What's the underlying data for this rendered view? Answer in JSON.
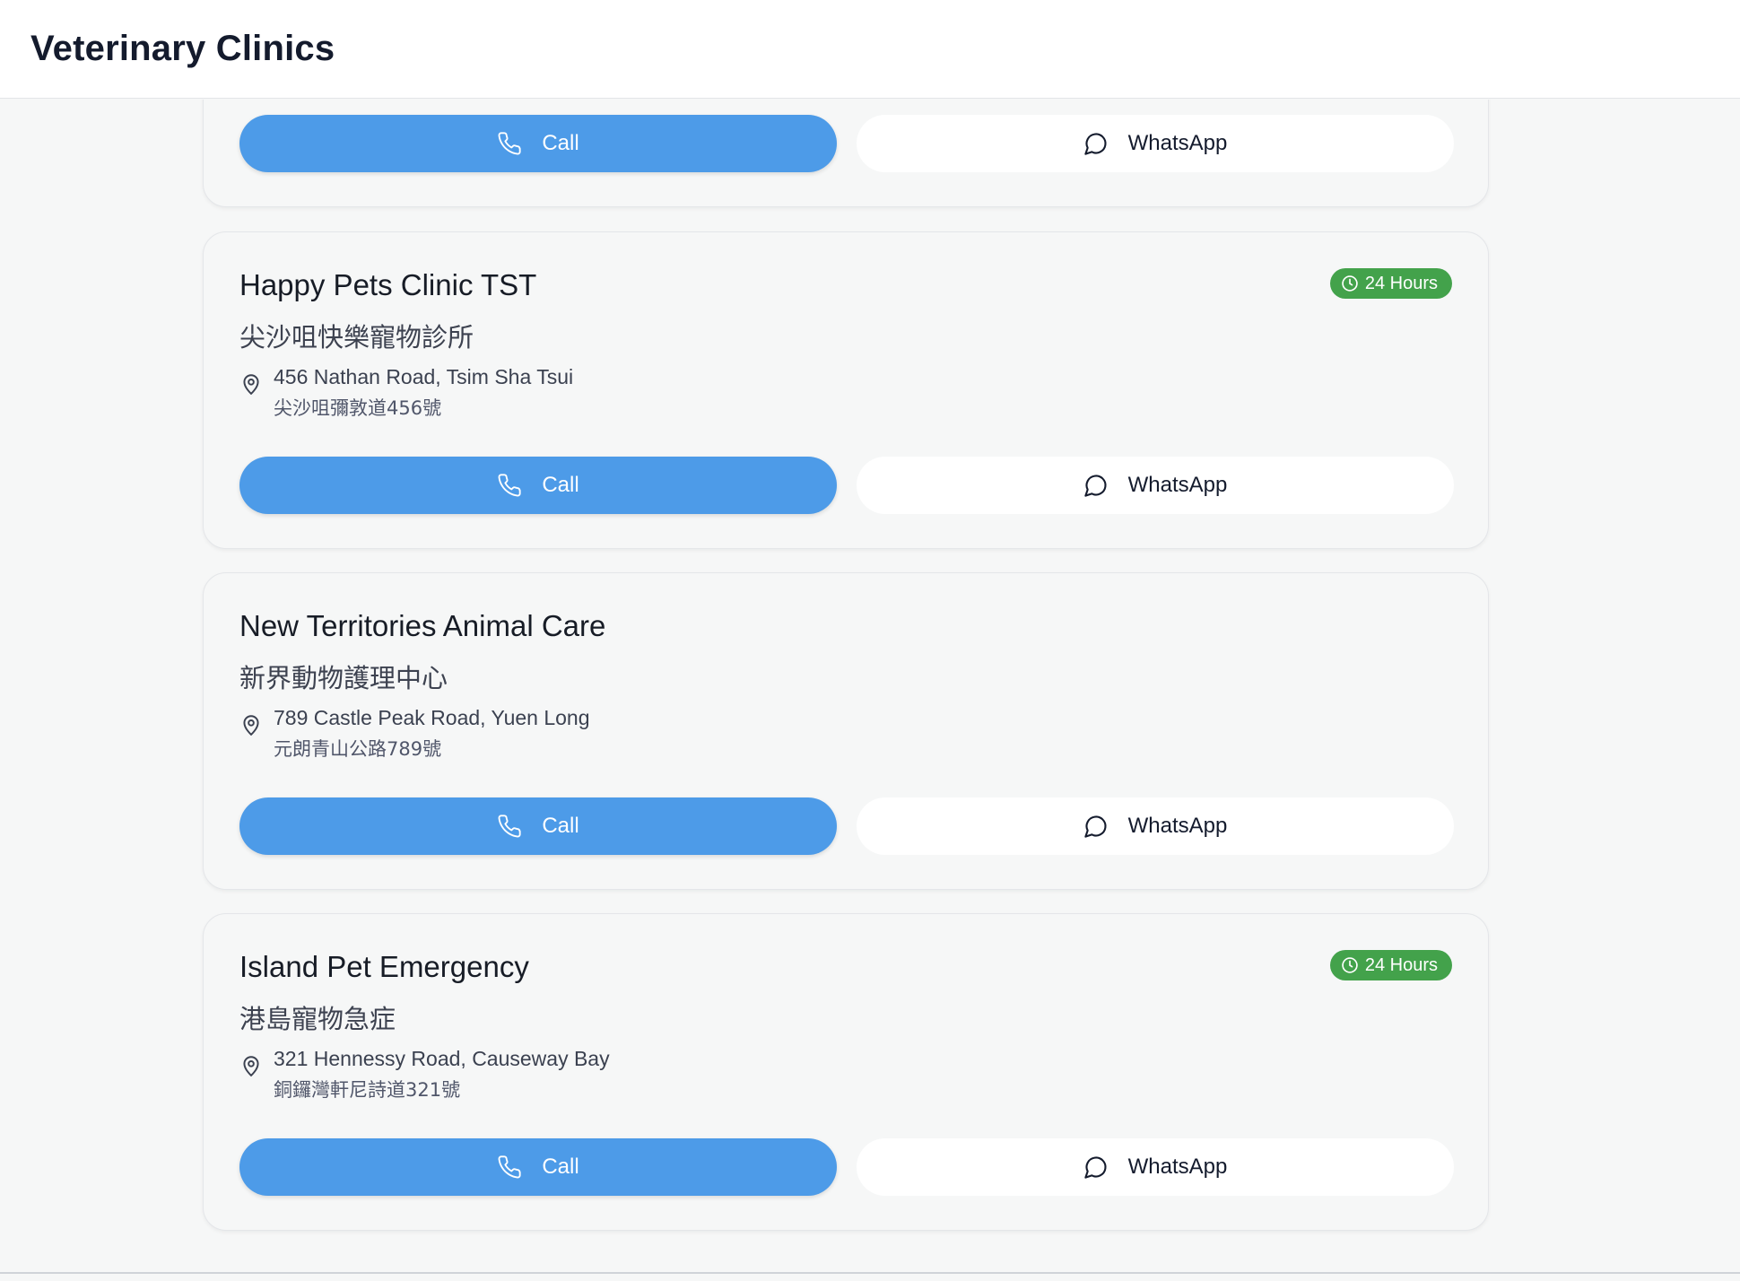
{
  "header": {
    "title": "Veterinary Clinics"
  },
  "actions": {
    "call_label": "Call",
    "whatsapp_label": "WhatsApp"
  },
  "colors": {
    "accent": "#4d9be8",
    "badge": "#43a24b",
    "background": "#f6f7f7"
  },
  "clinics": [
    {
      "partial": true
    },
    {
      "name": "Happy Pets Clinic TST",
      "name_zh": "尖沙咀快樂寵物診所",
      "address": "456 Nathan Road, Tsim Sha Tsui",
      "address_zh": "尖沙咀彌敦道456號",
      "badge": "24 Hours"
    },
    {
      "name": "New Territories Animal Care",
      "name_zh": "新界動物護理中心",
      "address": "789 Castle Peak Road, Yuen Long",
      "address_zh": "元朗青山公路789號",
      "badge": null
    },
    {
      "name": "Island Pet Emergency",
      "name_zh": "港島寵物急症",
      "address": "321 Hennessy Road, Causeway Bay",
      "address_zh": "銅鑼灣軒尼詩道321號",
      "badge": "24 Hours"
    }
  ]
}
